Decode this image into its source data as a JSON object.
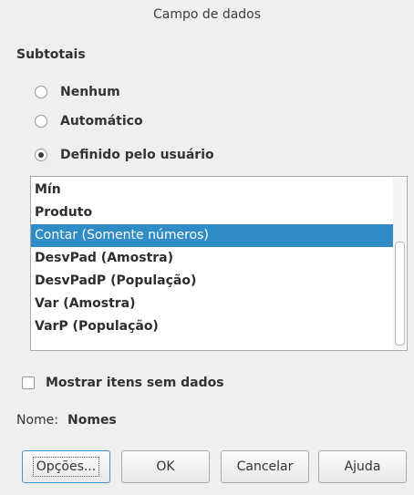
{
  "window": {
    "title": "Campo de dados"
  },
  "subtotals": {
    "label": "Subtotais",
    "options": [
      {
        "label": "Nenhum",
        "checked": false
      },
      {
        "label": "Automático",
        "checked": false
      },
      {
        "label": "Definido pelo usuário",
        "checked": true
      }
    ]
  },
  "functions": {
    "items": [
      {
        "label": "Mín",
        "selected": false
      },
      {
        "label": "Produto",
        "selected": false
      },
      {
        "label": "Contar (Somente números)",
        "selected": true
      },
      {
        "label": "DesvPad (Amostra)",
        "selected": false
      },
      {
        "label": "DesvPadP (População)",
        "selected": false
      },
      {
        "label": "Var (Amostra)",
        "selected": false
      },
      {
        "label": "VarP (População)",
        "selected": false
      }
    ]
  },
  "show_items": {
    "label": "Mostrar itens sem dados",
    "checked": false
  },
  "name": {
    "label": "Nome:",
    "value": "Nomes"
  },
  "buttons": {
    "options": "Opções...",
    "ok": "OK",
    "cancel": "Cancelar",
    "help": "Ajuda"
  },
  "colors": {
    "selection": "#308cc6",
    "background": "#efefef",
    "focus": "#3b97d3"
  }
}
